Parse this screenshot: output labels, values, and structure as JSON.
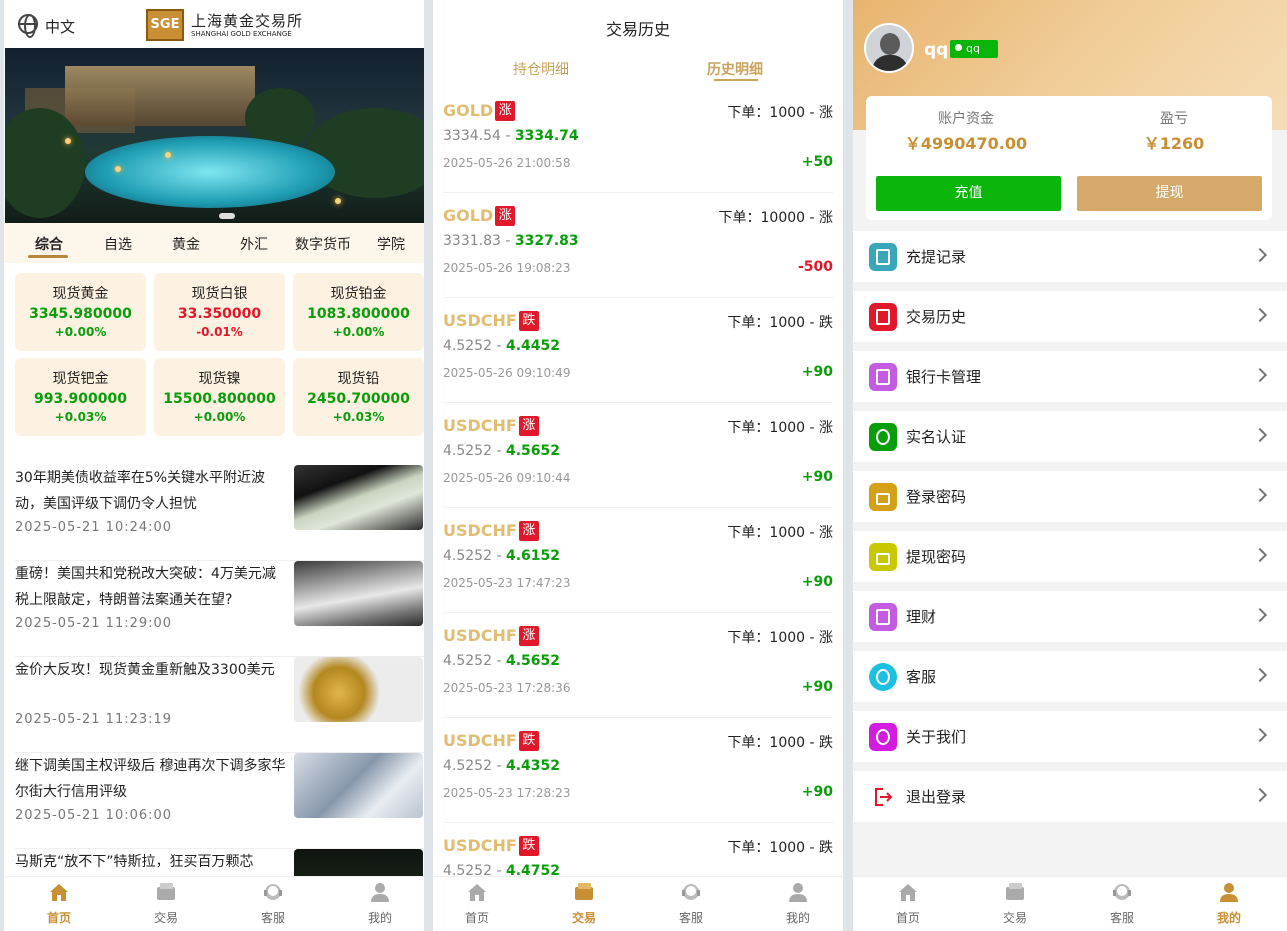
{
  "home": {
    "lang": "中文",
    "logo_cn": "上海黄金交易所",
    "logo_en": "SHANGHAI GOLD EXCHANGE",
    "logo_mark": "SGE",
    "tabs": [
      "综合",
      "自选",
      "黄金",
      "外汇",
      "数字货币",
      "学院"
    ],
    "quotes": [
      {
        "name": "现货黄金",
        "price": "3345.980000",
        "change": "+0.00%",
        "color": "green"
      },
      {
        "name": "现货白银",
        "price": "33.350000",
        "change": "-0.01%",
        "color": "red"
      },
      {
        "name": "现货铂金",
        "price": "1083.800000",
        "change": "+0.00%",
        "color": "green"
      },
      {
        "name": "现货钯金",
        "price": "993.900000",
        "change": "+0.03%",
        "color": "green"
      },
      {
        "name": "现货镍",
        "price": "15500.800000",
        "change": "+0.00%",
        "color": "green"
      },
      {
        "name": "现货铅",
        "price": "2450.700000",
        "change": "+0.03%",
        "color": "green"
      }
    ],
    "news": [
      {
        "title": "30年期美债收益率在5%关键水平附近波动，美国评级下调仍令人担忧",
        "date": "2025-05-21 10:24:00"
      },
      {
        "title": "重磅！美国共和党税改大突破：4万美元减税上限敲定，特朗普法案通关在望?",
        "date": "2025-05-21 11:29:00"
      },
      {
        "title": "金价大反攻！现货黄金重新触及3300美元",
        "date": "2025-05-21 11:23:19"
      },
      {
        "title": "继下调美国主权评级后 穆迪再次下调多家华尔街大行信用评级",
        "date": "2025-05-21 10:06:00"
      },
      {
        "title": "马斯克“放不下”特斯拉，狂买百万颗芯",
        "date": ""
      }
    ]
  },
  "nav": {
    "home": "首页",
    "trade": "交易",
    "service": "客服",
    "mine": "我的"
  },
  "history": {
    "title": "交易历史",
    "tab_positions": "持仓明细",
    "tab_history": "历史明细",
    "trades": [
      {
        "symbol": "GOLD",
        "dir": "涨",
        "order": "下单：1000 - 涨",
        "open": "3334.54",
        "close": "3334.74",
        "time": "2025-05-26 21:00:58",
        "pl": "+50",
        "pl_color": "green"
      },
      {
        "symbol": "GOLD",
        "dir": "涨",
        "order": "下单：10000 - 涨",
        "open": "3331.83",
        "close": "3327.83",
        "time": "2025-05-26 19:08:23",
        "pl": "-500",
        "pl_color": "red"
      },
      {
        "symbol": "USDCHF",
        "dir": "跌",
        "order": "下单：1000 - 跌",
        "open": "4.5252",
        "close": "4.4452",
        "time": "2025-05-26 09:10:49",
        "pl": "+90",
        "pl_color": "green"
      },
      {
        "symbol": "USDCHF",
        "dir": "涨",
        "order": "下单：1000 - 涨",
        "open": "4.5252",
        "close": "4.5652",
        "time": "2025-05-26 09:10:44",
        "pl": "+90",
        "pl_color": "green"
      },
      {
        "symbol": "USDCHF",
        "dir": "涨",
        "order": "下单：1000 - 涨",
        "open": "4.5252",
        "close": "4.6152",
        "time": "2025-05-23 17:47:23",
        "pl": "+90",
        "pl_color": "green"
      },
      {
        "symbol": "USDCHF",
        "dir": "涨",
        "order": "下单：1000 - 涨",
        "open": "4.5252",
        "close": "4.5652",
        "time": "2025-05-23 17:28:36",
        "pl": "+90",
        "pl_color": "green"
      },
      {
        "symbol": "USDCHF",
        "dir": "跌",
        "order": "下单：1000 - 跌",
        "open": "4.5252",
        "close": "4.4352",
        "time": "2025-05-23 17:28:23",
        "pl": "+90",
        "pl_color": "green"
      },
      {
        "symbol": "USDCHF",
        "dir": "跌",
        "order": "下单：1000 - 跌",
        "open": "4.5252",
        "close": "4.4752",
        "time": "",
        "pl": "",
        "pl_color": "green"
      }
    ]
  },
  "profile": {
    "username": "qq",
    "badge": "qq",
    "balance_label": "账户资金",
    "balance": "￥4990470.00",
    "pl_label": "盈亏",
    "pl": "￥1260",
    "deposit": "充值",
    "withdraw": "提现",
    "menu": [
      {
        "label": "充提记录",
        "icon": "record-icon",
        "color": "#3aa6b9"
      },
      {
        "label": "交易历史",
        "icon": "history-icon",
        "color": "#e0182a"
      },
      {
        "label": "银行卡管理",
        "icon": "bank-card-icon",
        "color": "#c45be0"
      },
      {
        "label": "实名认证",
        "icon": "verify-icon",
        "color": "#0a9d0a"
      },
      {
        "label": "登录密码",
        "icon": "lock-icon",
        "color": "#d4a017"
      },
      {
        "label": "提现密码",
        "icon": "lock-icon",
        "color": "#c8c800"
      },
      {
        "label": "理财",
        "icon": "finance-icon",
        "color": "#c45be0"
      },
      {
        "label": "客服",
        "icon": "service-icon",
        "color": "#1ec0e0"
      },
      {
        "label": "关于我们",
        "icon": "about-icon",
        "color": "#d21ce0"
      },
      {
        "label": "退出登录",
        "icon": "logout-icon",
        "color": "#e0182a"
      }
    ]
  },
  "colors": {
    "accent": "#c98f34",
    "green": "#0a9d0a",
    "red": "#e0182a"
  }
}
